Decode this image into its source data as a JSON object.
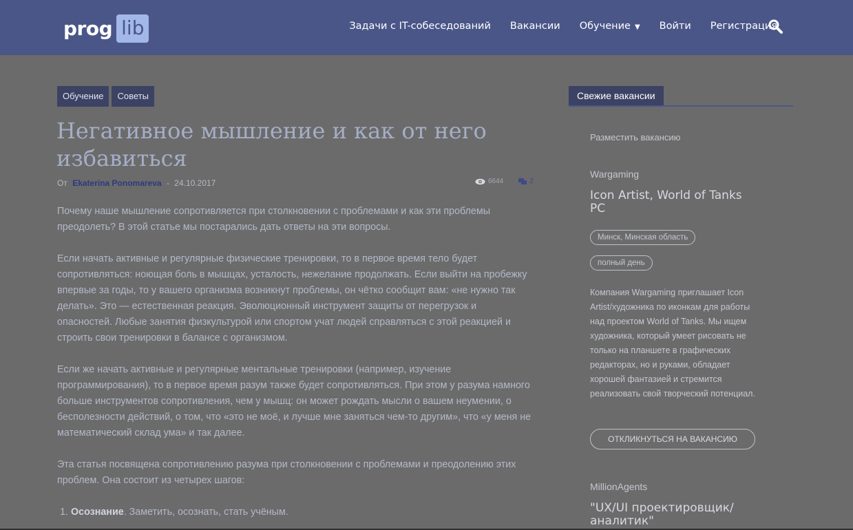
{
  "header": {
    "logo_prog": "prog",
    "logo_lib": "lib",
    "nav": {
      "tasks": "Задачи с IT-собеседований",
      "jobs": "Вакансии",
      "learning": "Обучение",
      "login": "Войти",
      "register": "Регистрация"
    }
  },
  "article": {
    "tags": [
      "Обучение",
      "Советы"
    ],
    "title": "Негативное мышление и как от него избавиться",
    "meta_prefix": "От",
    "author": "Ekaterina Ponomareva",
    "separator": "-",
    "date": "24.10.2017",
    "views": "6644",
    "comments": "2",
    "paragraphs": [
      "Почему наше мышление сопротивляется при столкновении с проблемами и как эти проблемы преодолеть? В этой статье мы постарались дать ответы на эти вопросы.",
      "Если начать активные и регулярные физические тренировки, то в первое время тело будет сопротивляться: ноющая боль в мышцах, усталость, нежелание продолжать. Если выйти на пробежку впервые за годы, то у вашего организма возникнут проблемы, он чётко сообщит вам: «не нужно так делать». Это — естественная реакция. Эволюционный инструмент защиты от перегрузок и опасностей. Любые занятия физкультурой или спортом учат людей справляться с этой реакцией и строить свои тренировки в балансе с организмом.",
      "Если же начать активные и регулярные ментальные тренировки (например, изучение программирования), то в первое время разум также будет сопротивляться. При этом у разума намного больше инструментов сопротивления, чем у мышц: он может рождать мысли о вашем неумении, о бесполезности действий, о том, что «это не моё, и лучше мне заняться чем-то другим», что «у меня не математический склад ума» и так далее.",
      "Эта статья посвящена сопротивлению разума при столкновении с проблемами и преодолению этих проблем. Она состоит из четырех шагов:"
    ],
    "list_item_1_bold": "Осознание",
    "list_item_1_rest": ". Заметить, осознать, стать учёным."
  },
  "sidebar": {
    "widget_title": "Свежие вакансии",
    "post_job": "Разместить вакансию",
    "job1": {
      "company": "Wargaming",
      "title": "Icon Artist, World of Tanks PC",
      "location": "Минск, Минская область",
      "type": "полный день",
      "description": "Компания Wargaming приглашает Icon Artist/художника по иконкам для работы над проектом World of Tanks. Мы ищем художника, который умеет рисовать не только на планшете в графических редакторах, но и руками, обладает хорошей фантазией и стремится реализовать свой творческий потенциал.",
      "apply": "ОТКЛИКНУТЬСЯ НА ВАКАНСИЮ"
    },
    "job2": {
      "company": "MillionAgents",
      "title": "\"UX/UI проектировщик/ аналитик\""
    }
  }
}
